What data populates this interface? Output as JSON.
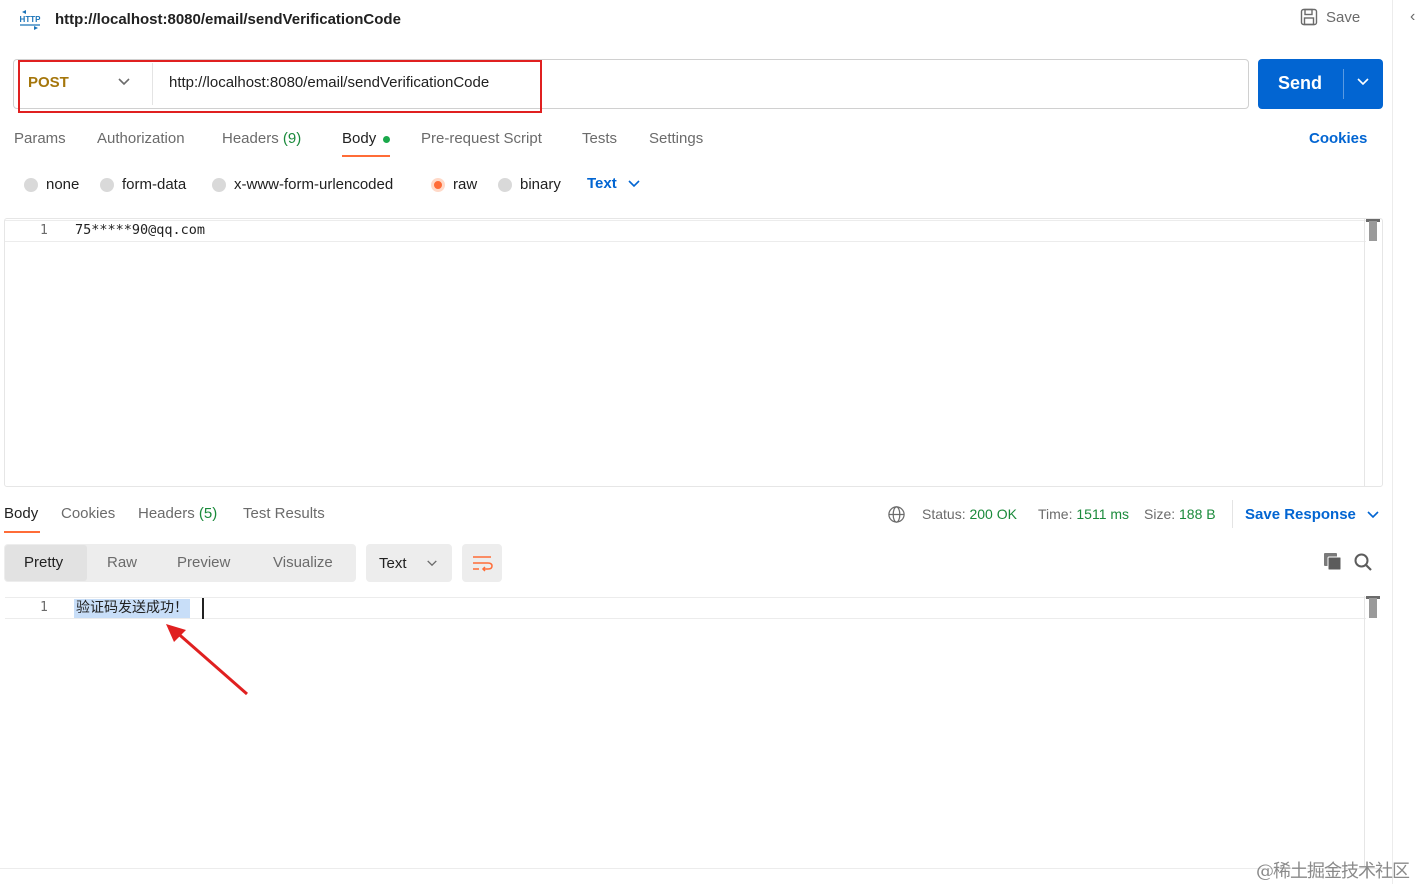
{
  "header": {
    "icon_label": "HTTP",
    "title": "http://localhost:8080/email/sendVerificationCode",
    "save_label": "Save"
  },
  "request": {
    "method": "POST",
    "url": "http://localhost:8080/email/sendVerificationCode",
    "send_label": "Send"
  },
  "request_tabs": {
    "params": "Params",
    "authorization": "Authorization",
    "headers": "Headers",
    "headers_count": "(9)",
    "body": "Body",
    "prerequest": "Pre-request Script",
    "tests": "Tests",
    "settings": "Settings",
    "cookies": "Cookies"
  },
  "body_types": {
    "none": "none",
    "form_data": "form-data",
    "urlencoded": "x-www-form-urlencoded",
    "raw": "raw",
    "binary": "binary",
    "selected": "raw",
    "format": "Text"
  },
  "request_editor": {
    "line_number": "1",
    "line_text": "75*****90@qq.com"
  },
  "response_tabs": {
    "body": "Body",
    "cookies": "Cookies",
    "headers": "Headers",
    "headers_count": "(5)",
    "test_results": "Test Results"
  },
  "response_status": {
    "status_label": "Status:",
    "status_value": "200 OK",
    "time_label": "Time:",
    "time_value": "1511 ms",
    "size_label": "Size:",
    "size_value": "188 B",
    "save_response": "Save Response"
  },
  "response_toolbar": {
    "pretty": "Pretty",
    "raw": "Raw",
    "preview": "Preview",
    "visualize": "Visualize",
    "format": "Text"
  },
  "response_editor": {
    "line_number": "1",
    "line_text": "验证码发送成功！"
  },
  "colors": {
    "accent": "#ff6c37",
    "send_button": "#0265d2",
    "method_post": "#a5760b",
    "status_ok": "#1a8a3b",
    "annotation": "#e02020"
  },
  "watermark": "@稀土掘金技术社区"
}
